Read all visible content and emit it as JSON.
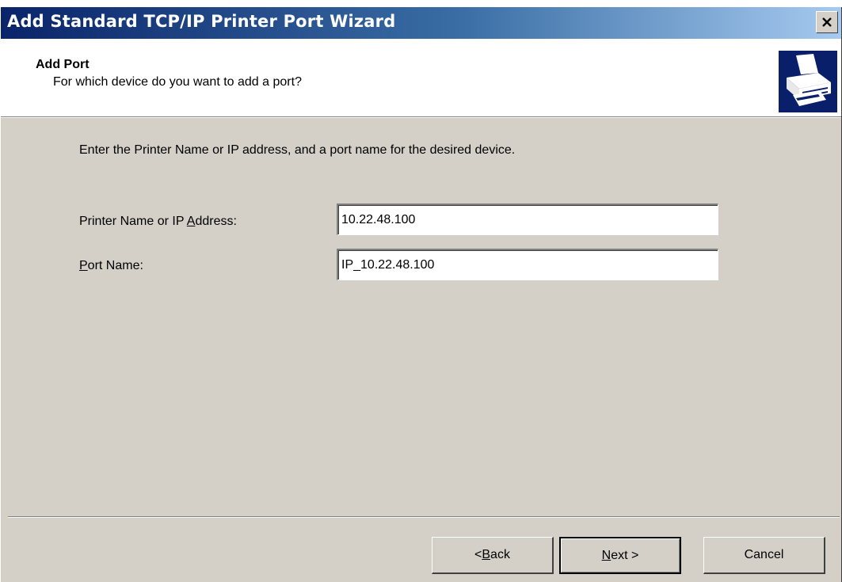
{
  "window": {
    "title": "Add Standard TCP/IP Printer Port Wizard",
    "close_glyph": "×"
  },
  "header": {
    "title": "Add Port",
    "subtitle": "For which device do you want to add a port?"
  },
  "body": {
    "instruction": "Enter the Printer Name or IP address, and a port name for the desired device.",
    "printer_field": {
      "label_before": "Printer Name or IP ",
      "label_mnemonic": "A",
      "label_after": "ddress:",
      "value": "10.22.48.100"
    },
    "port_field": {
      "label_before": "",
      "label_mnemonic": "P",
      "label_after": "ort Name:",
      "value": "IP_10.22.48.100"
    }
  },
  "buttons": {
    "back": {
      "prefix": "< ",
      "mnemonic": "B",
      "rest": "ack"
    },
    "next": {
      "prefix": "",
      "mnemonic": "N",
      "rest": "ext >"
    },
    "cancel": {
      "label": "Cancel"
    }
  },
  "colors": {
    "titlebar_start": "#0a246a",
    "titlebar_end": "#a6caf0",
    "dialog_face": "#d4d0c8",
    "icon_bg": "#0a1f6a"
  },
  "icons": {
    "wizard_icon": "printer-icon",
    "close_icon": "close-icon"
  }
}
